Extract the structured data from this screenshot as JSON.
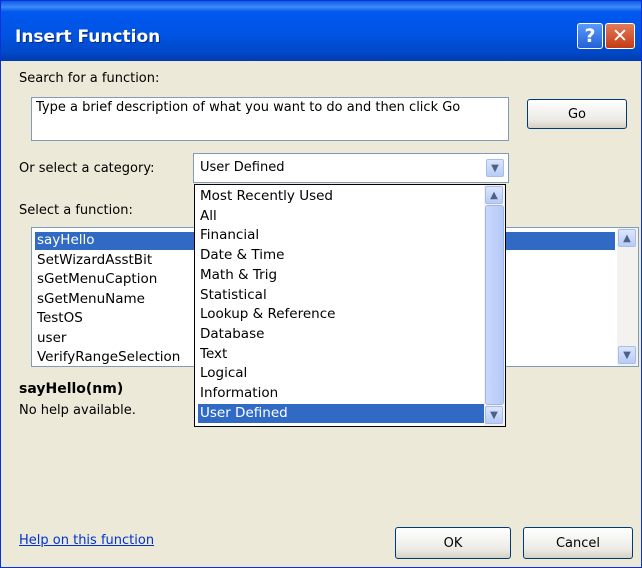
{
  "dialog": {
    "title": "Insert Function",
    "help_glyph": "?",
    "close_glyph": "✕"
  },
  "search": {
    "label": "Search for a function:",
    "value": "Type a brief description of what you want to do and then click Go",
    "go_label": "Go"
  },
  "category": {
    "label": "Or select a category:",
    "selected": "User Defined",
    "options": [
      "Most Recently Used",
      "All",
      "Financial",
      "Date & Time",
      "Math & Trig",
      "Statistical",
      "Lookup & Reference",
      "Database",
      "Text",
      "Logical",
      "Information",
      "User Defined"
    ]
  },
  "functions": {
    "label": "Select a function:",
    "items": [
      "sayHello",
      "SetWizardAsstBit",
      "sGetMenuCaption",
      "sGetMenuName",
      "TestOS",
      "user",
      "VerifyRangeSelection"
    ],
    "selected_index": 0
  },
  "details": {
    "signature": "sayHello(nm)",
    "description": "No help available."
  },
  "footer": {
    "help_link": "Help on this function",
    "ok_label": "OK",
    "cancel_label": "Cancel"
  },
  "colors": {
    "titlebar": "#0054e3",
    "selection": "#316ac5",
    "dialog_bg": "#ece9d8",
    "link": "#0033cc"
  }
}
